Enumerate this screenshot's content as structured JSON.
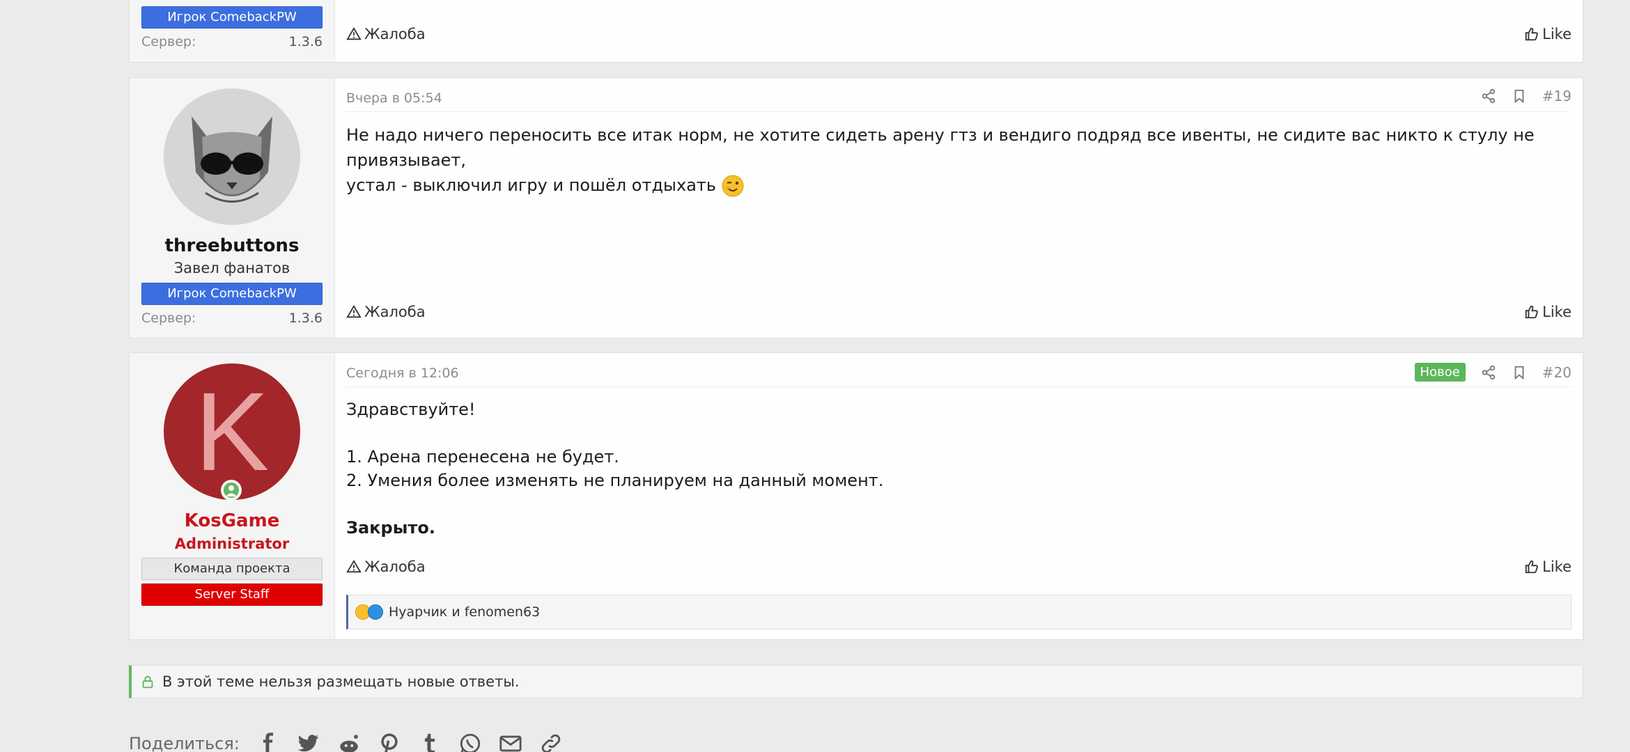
{
  "prev_post": {
    "banner": "Игрок ComebackPW",
    "server_label": "Сервер:",
    "server_value": "1.3.6",
    "report": "Жалоба",
    "like": "Like"
  },
  "post19": {
    "date": "Вчера в 05:54",
    "number": "#19",
    "username": "threebuttons",
    "user_title": "Завел фанатов",
    "banner": "Игрок ComebackPW",
    "server_label": "Сервер:",
    "server_value": "1.3.6",
    "text_line1": "Не надо ничего переносить все итак норм, не хотите сидеть арену гтз и вендиго подряд все ивенты, не сидите вас никто к стулу не привязывает,",
    "text_line2": "устал - выключил игру и пошёл отдыхать",
    "report": "Жалоба",
    "like": "Like"
  },
  "post20": {
    "date": "Сегодня в 12:06",
    "new_badge": "Новое",
    "number": "#20",
    "avatar_letter": "K",
    "username": "KosGame",
    "user_title": "Administrator",
    "banner_team": "Команда проекта",
    "banner_staff": "Server Staff",
    "greeting": "Здравствуйте!",
    "line1": "1. Арена перенесена не будет.",
    "line2": "2. Умения более изменять не планируем на данный момент.",
    "closing": "Закрыто.",
    "report": "Жалоба",
    "like": "Like",
    "reactions_text": "Нуарчик и fenomen63"
  },
  "notice": "В этой теме нельзя размещать новые ответы.",
  "share_label": "Поделиться:",
  "colors": {
    "accent_blue": "#3d6ee0",
    "admin_red": "#c8161d",
    "staff_red": "#e00000",
    "new_green": "#5bb75b"
  }
}
